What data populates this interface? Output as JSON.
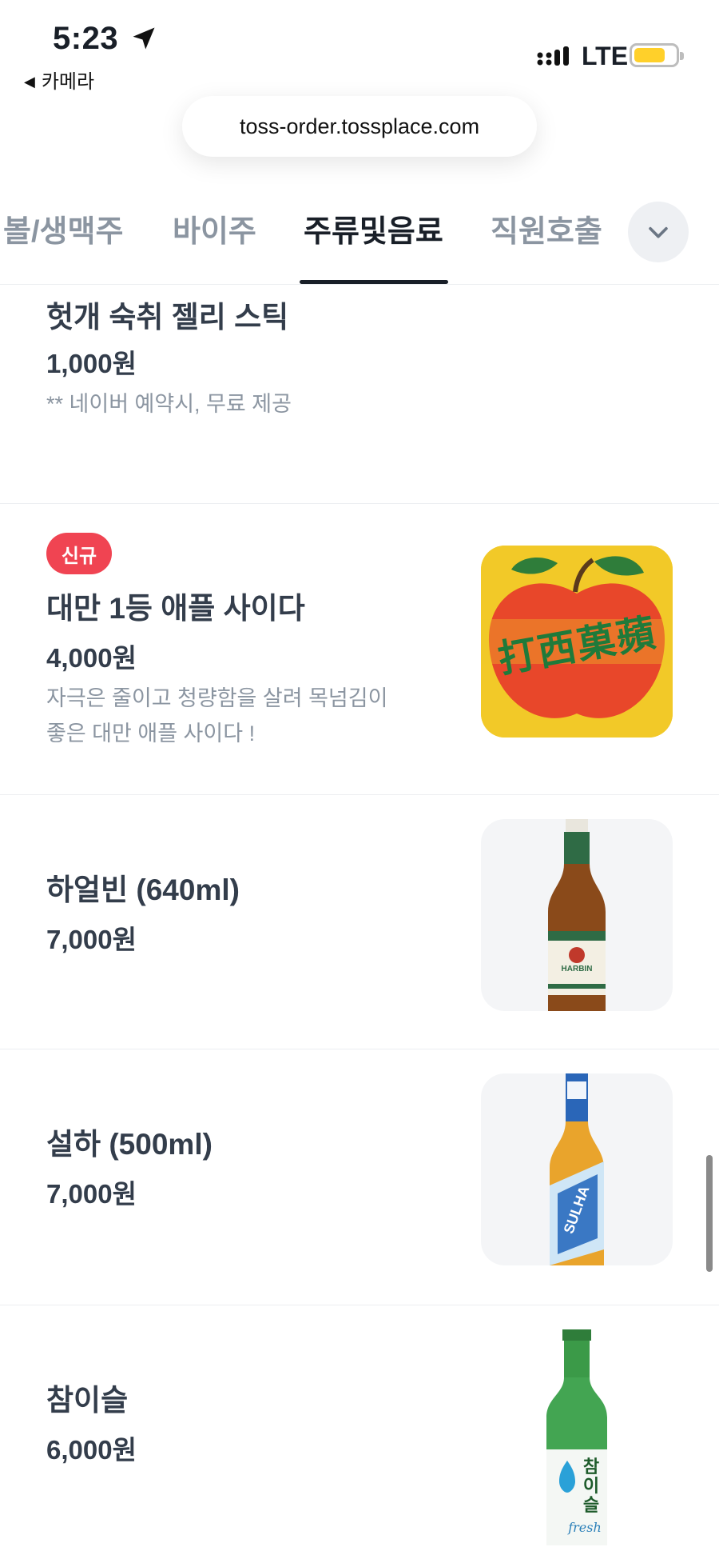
{
  "status_bar": {
    "time": "5:23",
    "back_app": "카메라",
    "network": "LTE",
    "battery_color": "#ffd02a"
  },
  "browser": {
    "url": "toss-order.tossplace.com"
  },
  "tabs": {
    "items": [
      {
        "label": "볼/생맥주",
        "active": false
      },
      {
        "label": "바이주",
        "active": false
      },
      {
        "label": "주류및음료",
        "active": true
      },
      {
        "label": "직원호출",
        "active": false
      }
    ],
    "more_icon": "chevron-down-icon"
  },
  "menu": {
    "items": [
      {
        "name": "헛개 숙취 젤리 스틱",
        "price": "1,000원",
        "description": "** 네이버 예약시, 무료 제공"
      },
      {
        "badge": "신규",
        "name": "대만 1등 애플 사이다",
        "price": "4,000원",
        "description_line1": "자극은 줄이고 청량함을 살려 목넘김이",
        "description_line2": "좋은 대만 애플 사이다 !",
        "image_text": "打西菓蘋"
      },
      {
        "name": "하얼빈 (640ml)",
        "price": "7,000원",
        "image_label": "HARBIN"
      },
      {
        "name": "설하 (500ml)",
        "price": "7,000원",
        "image_label": "SULHA"
      },
      {
        "name": "참이슬",
        "price": "6,000원",
        "image_label": "참이슬",
        "image_sublabel": "fresh"
      }
    ]
  },
  "colors": {
    "accent_badge": "#f04452",
    "text_primary": "#333d4b",
    "text_secondary": "#8b95a1"
  }
}
